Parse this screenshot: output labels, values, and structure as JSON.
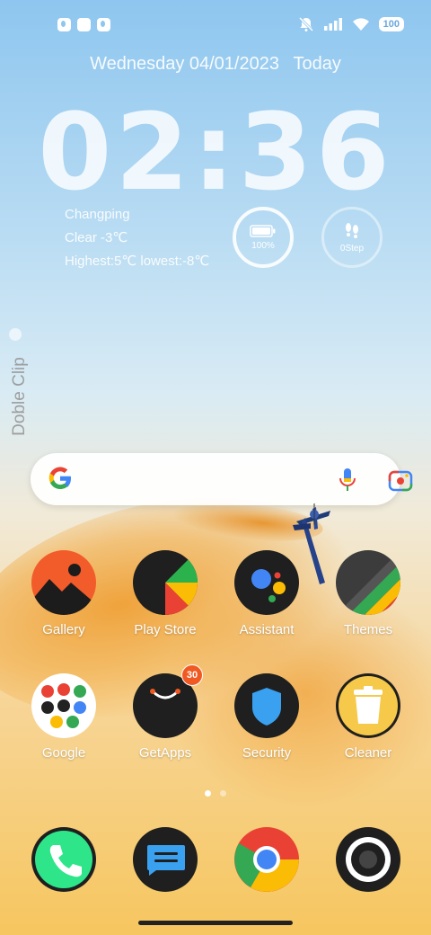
{
  "status_bar": {
    "left_icons": [
      "notification-icon",
      "square-icon",
      "notification-icon"
    ],
    "right_icons": [
      "silent-bell-icon",
      "signal-icon",
      "wifi-icon"
    ],
    "battery_level": "100"
  },
  "lockscreen": {
    "date_text": "Wednesday 04/01/2023",
    "date_suffix": "Today",
    "time": "02:36",
    "weather": {
      "location": "Changping",
      "condition": "Clear -3℃",
      "range": "Highest:5℃ lowest:-8℃"
    },
    "battery_widget": {
      "label": "100%",
      "fraction": 1.0
    },
    "steps_widget": {
      "label": "0Step"
    }
  },
  "side_panel": {
    "label": "Doble Clip"
  },
  "search_bar": {
    "icons": [
      "google-icon",
      "mic-icon",
      "lens-icon"
    ]
  },
  "apps": [
    {
      "name": "Gallery",
      "icon": "gallery-icon"
    },
    {
      "name": "Play Store",
      "icon": "play-store-icon"
    },
    {
      "name": "Assistant",
      "icon": "assistant-icon"
    },
    {
      "name": "Themes",
      "icon": "themes-icon"
    },
    {
      "name": "Google",
      "icon": "google-folder-icon"
    },
    {
      "name": "GetApps",
      "icon": "getapps-icon",
      "badge": "30"
    },
    {
      "name": "Security",
      "icon": "security-shield-icon"
    },
    {
      "name": "Cleaner",
      "icon": "cleaner-trash-icon"
    }
  ],
  "page_indicator": {
    "pages": 2,
    "current": 1
  },
  "dock": [
    {
      "icon": "phone-icon"
    },
    {
      "icon": "messages-icon"
    },
    {
      "icon": "chrome-icon"
    },
    {
      "icon": "camera-icon"
    }
  ],
  "colors": {
    "sky_top": "#8ec6ef",
    "sky_bottom": "#f6c65f",
    "badge": "#f05a22",
    "phone_green": "#2ee58a",
    "messages_blue": "#3aa0f0"
  }
}
